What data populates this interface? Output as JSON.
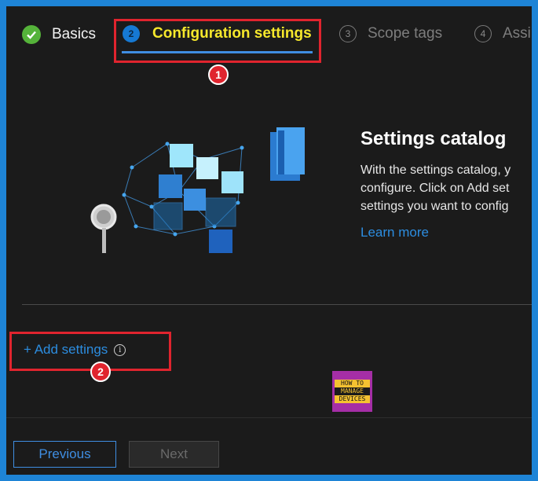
{
  "wizard": {
    "steps": [
      {
        "number": "",
        "label": "Basics",
        "state": "completed"
      },
      {
        "number": "2",
        "label": "Configuration settings",
        "state": "current"
      },
      {
        "number": "3",
        "label": "Scope tags",
        "state": "pending"
      },
      {
        "number": "4",
        "label": "Assi",
        "state": "pending"
      }
    ]
  },
  "annotations": [
    "1",
    "2"
  ],
  "catalog": {
    "title": "Settings catalog",
    "description_lines": [
      "With the settings catalog, y",
      "configure. Click on Add set",
      "settings you want to config"
    ],
    "learn_more": "Learn more"
  },
  "add_settings": {
    "label": "+ Add settings",
    "info_glyph": "i"
  },
  "logo": {
    "lines": [
      "HOW TO",
      "MANAGE",
      "DEVICES"
    ]
  },
  "footer": {
    "previous_label": "Previous",
    "next_label": "Next"
  },
  "colors": {
    "accent": "#1e84d6",
    "current_step_text": "#f6e82c",
    "annotation": "#e0242e",
    "link": "#2c8de0",
    "success": "#55b33a"
  }
}
